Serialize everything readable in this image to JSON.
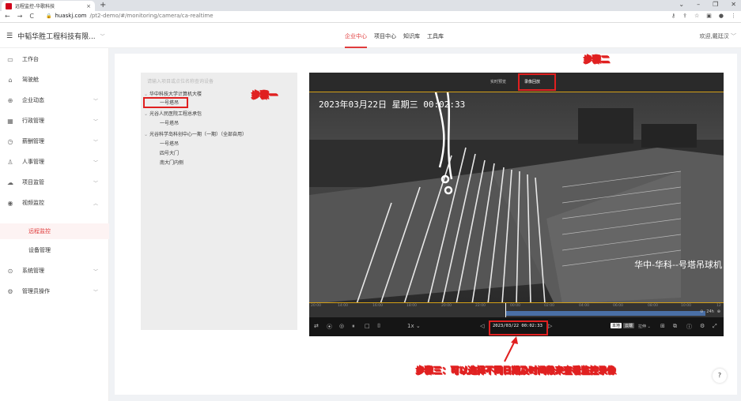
{
  "browser": {
    "tab_title": "远程监控-华歌科技",
    "tab_close": "×",
    "new_tab": "+",
    "url_host": "huaskj.com",
    "url_path": "/pt2-demo/#/monitoring/camera/ca-realtime"
  },
  "header": {
    "org_name": "中韬华胜工程科技有限...",
    "nav": [
      "企业中心",
      "项目中心",
      "知识库",
      "工具库"
    ],
    "welcome": "欢迎,戴廷汉"
  },
  "sidebar": {
    "items": [
      {
        "label": "工作台",
        "icon": "monitor-icon"
      },
      {
        "label": "驾驶舱",
        "icon": "home-icon"
      },
      {
        "label": "企业动态",
        "icon": "globe-icon"
      },
      {
        "label": "行政管理",
        "icon": "building-icon"
      },
      {
        "label": "薪酬管理",
        "icon": "clock-icon"
      },
      {
        "label": "人事管理",
        "icon": "person-icon"
      },
      {
        "label": "项目监管",
        "icon": "cloud-icon"
      },
      {
        "label": "视频监控",
        "icon": "location-icon"
      },
      {
        "label": "系统管理",
        "icon": "settings-icon"
      },
      {
        "label": "管理员操作",
        "icon": "gear-icon"
      }
    ],
    "sub_items": [
      "远程监控",
      "设备管理"
    ]
  },
  "tree": {
    "placeholder": "请输入项目或点位名称查询设备",
    "rows": [
      "华中科技大学计算机大楼",
      "一号塔吊",
      "光谷人民医院工程总承包",
      "一号塔吊",
      "光谷科学岛科创中心一期（一期）（全部自用）",
      "一号塔吊",
      "四号大门",
      "南大门内侧"
    ]
  },
  "player": {
    "tabs": [
      "实时预览",
      "录像回放"
    ],
    "osd_time": "2023年03月22日 星期三 00:02:33",
    "osd_name": "华中-华科--号塔吊球机",
    "timeline_labels": [
      "20:00",
      "14:00",
      "16:00",
      "18:00",
      "20:00",
      "22:00",
      "00:00",
      "02:00",
      "04:00",
      "06:00",
      "08:00",
      "10:00",
      "12"
    ],
    "zoom_label": "24h",
    "speed": "1x",
    "date_time": "2023/03/22 00:02:33",
    "badge_local": "本地",
    "badge_cloud": "云端",
    "stretch": "拉伸"
  },
  "annotations": {
    "step1": "步骤一",
    "step2": "步骤二",
    "step3": "步骤三：可以选择不同日期及时间段来查看监控录像"
  },
  "help": "?",
  "colors": {
    "accent": "#e03c3c",
    "annotation": "#e02020",
    "timeline_fill": "#4a6fa5"
  }
}
